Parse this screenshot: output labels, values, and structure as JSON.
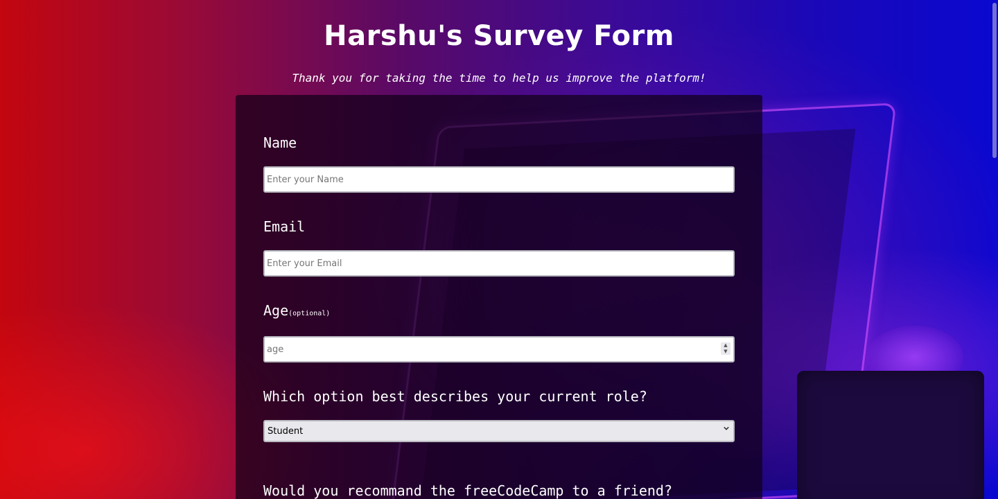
{
  "header": {
    "title": "Harshu's Survey Form",
    "description": "Thank you for taking the time to help us improve the platform!"
  },
  "form": {
    "name": {
      "label": "Name",
      "placeholder": "Enter your Name",
      "value": ""
    },
    "email": {
      "label": "Email",
      "placeholder": "Enter your Email",
      "value": ""
    },
    "age": {
      "label": "Age",
      "optional_note": "(optional)",
      "placeholder": "age",
      "value": ""
    },
    "role": {
      "question": "Which option best describes your current role?",
      "selected": "Student"
    },
    "recommend": {
      "question": "Would you recommand the freeCodeCamp to a friend?"
    }
  },
  "icons": {
    "age_spinner": "spinner-arrows-icon",
    "role_dropdown": "chevron-down-icon"
  },
  "colors": {
    "background_left": "#c3060f",
    "background_right": "#0a08d0",
    "card": "#100018",
    "text": "#ffffff"
  }
}
